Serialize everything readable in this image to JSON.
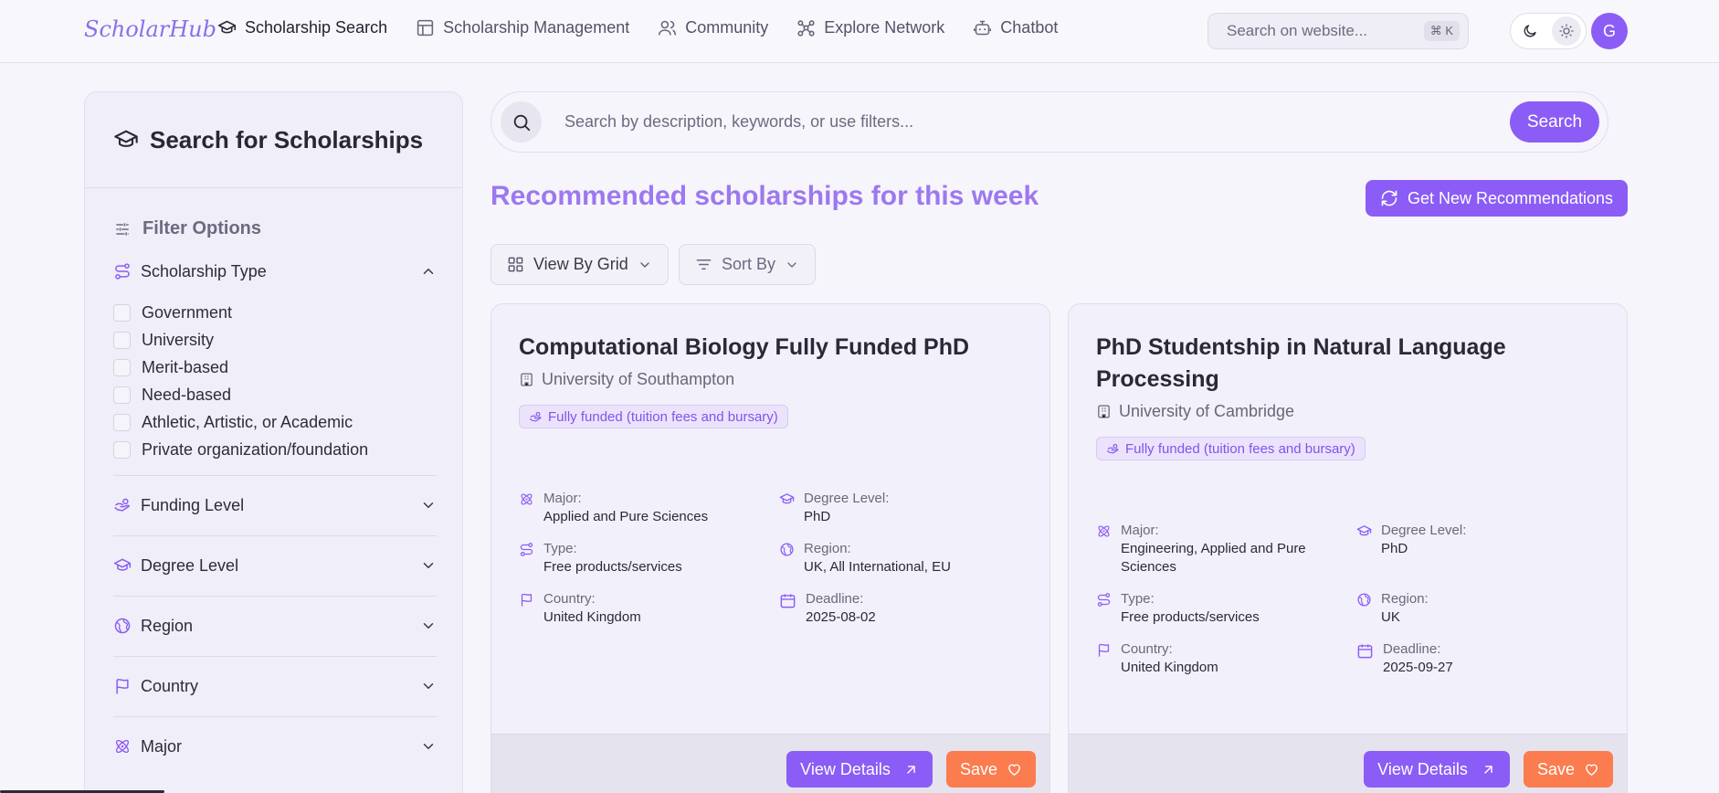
{
  "app": {
    "logo": "ScholarHub"
  },
  "nav": {
    "items": [
      {
        "label": "Scholarship Search",
        "icon": "graduation-cap-icon",
        "active": true
      },
      {
        "label": "Scholarship Management",
        "icon": "table-icon"
      },
      {
        "label": "Community",
        "icon": "users-icon"
      },
      {
        "label": "Explore Network",
        "icon": "network-icon"
      },
      {
        "label": "Chatbot",
        "icon": "bot-icon"
      }
    ],
    "site_search_placeholder": "Search on website...",
    "shortcut": "⌘ K",
    "avatar_initial": "G"
  },
  "sidebar": {
    "title": "Search for Scholarships",
    "filter_heading": "Filter Options",
    "sections": [
      {
        "label": "Scholarship Type",
        "icon": "route-icon",
        "expanded": true,
        "options": [
          "Government",
          "University",
          "Merit-based",
          "Need-based",
          "Athletic, Artistic, or Academic",
          "Private organization/foundation"
        ]
      },
      {
        "label": "Funding Level",
        "icon": "hand-coins-icon",
        "expanded": false
      },
      {
        "label": "Degree Level",
        "icon": "graduation-cap-icon",
        "expanded": false
      },
      {
        "label": "Region",
        "icon": "globe-icon",
        "expanded": false
      },
      {
        "label": "Country",
        "icon": "flag-icon",
        "expanded": false
      },
      {
        "label": "Major",
        "icon": "atom-icon",
        "expanded": false
      }
    ]
  },
  "search": {
    "placeholder": "Search by description, keywords, or use filters...",
    "button": "Search"
  },
  "recommendations": {
    "heading": "Recommended scholarships for this week",
    "refresh_button": "Get New Recommendations",
    "view_button": "View By Grid",
    "sort_button": "Sort By"
  },
  "cards": [
    {
      "title": "Computational Biology Fully Funded PhD",
      "university": "University of Southampton",
      "funding": "Fully funded (tuition fees and bursary)",
      "major_label": "Major:",
      "major": "Applied and Pure Sciences",
      "degree_label": "Degree Level:",
      "degree": "PhD",
      "type_label": "Type:",
      "type": "Free products/services",
      "region_label": "Region:",
      "region": "UK, All International, EU",
      "country_label": "Country:",
      "country": "United Kingdom",
      "deadline_label": "Deadline:",
      "deadline": "2025-08-02",
      "details_button": "View Details",
      "save_button": "Save"
    },
    {
      "title": "PhD Studentship in Natural Language Processing",
      "university": "University of Cambridge",
      "funding": "Fully funded (tuition fees and bursary)",
      "major_label": "Major:",
      "major": "Engineering, Applied and Pure Sciences",
      "degree_label": "Degree Level:",
      "degree": "PhD",
      "type_label": "Type:",
      "type": "Free products/services",
      "region_label": "Region:",
      "region": "UK",
      "country_label": "Country:",
      "country": "United Kingdom",
      "deadline_label": "Deadline:",
      "deadline": "2025-09-27",
      "details_button": "View Details",
      "save_button": "Save"
    }
  ],
  "colors": {
    "accent": "#8b5cf6",
    "heading": "#9d78ef",
    "save": "#fb7c4e",
    "badge_bg": "#ebe3fb"
  }
}
